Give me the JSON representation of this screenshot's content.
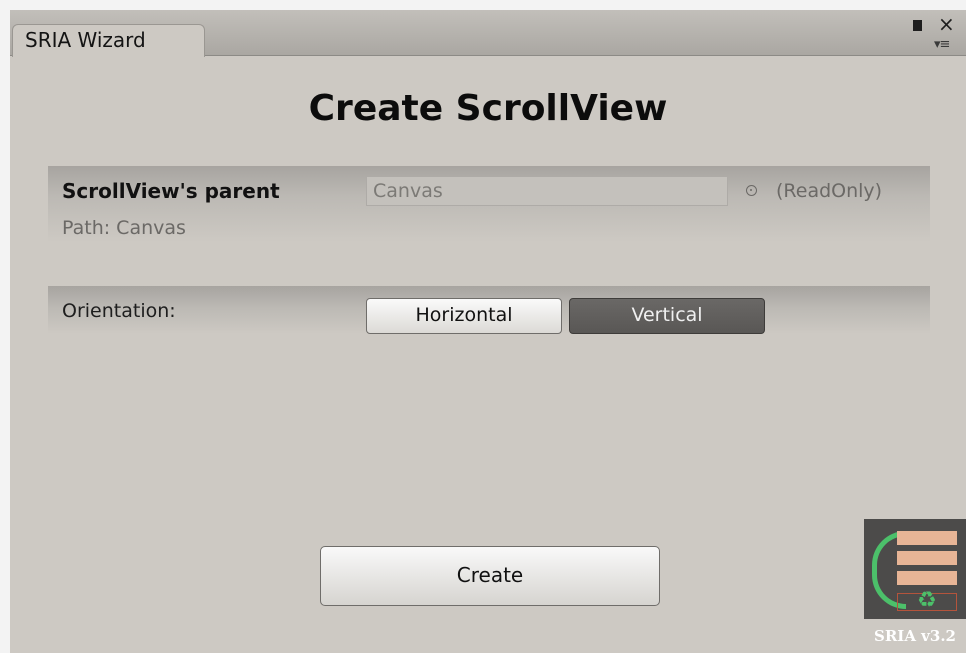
{
  "window": {
    "tab_title": "SRIA Wizard",
    "controls": {
      "maximize_icon": "maximize-icon",
      "close_glyph": "×",
      "menu_glyph": "▾≡"
    }
  },
  "main": {
    "title": "Create ScrollView"
  },
  "parent_section": {
    "label": "ScrollView's parent",
    "field_value": "Canvas",
    "picker_icon": "target-icon",
    "readonly_text": "(ReadOnly)",
    "path_text": "Path: Canvas"
  },
  "orientation_section": {
    "label": "Orientation:",
    "options": [
      "Horizontal",
      "Vertical"
    ],
    "selected": "Vertical"
  },
  "actions": {
    "create_label": "Create"
  },
  "branding": {
    "version_label": "SRIA v3.2",
    "logo_icon": "sria-logo-icon",
    "recycle_glyph": "♻"
  },
  "colors": {
    "window_bg": "#cdc9c3",
    "selected_button": "#5f5d5b",
    "logo_green": "#4cc06a",
    "logo_peach": "#e8b596"
  }
}
